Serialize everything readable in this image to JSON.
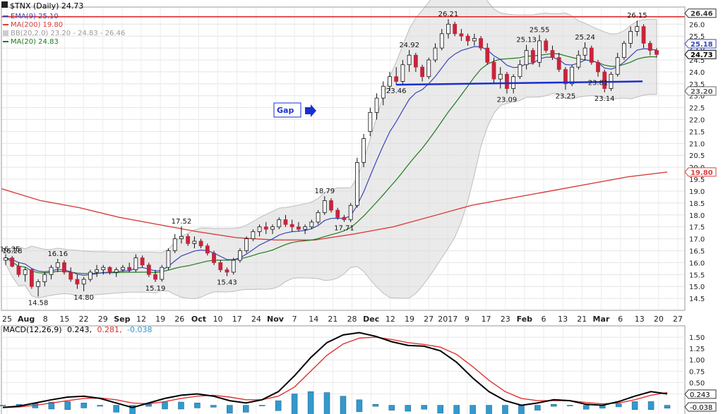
{
  "chart_data": [
    {
      "type": "candlestick",
      "symbol_label": "$TNX (Daily) 24.73",
      "legend": [
        {
          "name": "EMA(9) 25.10",
          "color": "#3a46b8"
        },
        {
          "name": "MA(200) 19.80",
          "color": "#d84040"
        },
        {
          "name": "BB(20,2.0) 23.20 - 24.83 - 26.46",
          "color": "#9a9a9a"
        },
        {
          "name": "MA(20) 24.83",
          "color": "#1e7a1e"
        }
      ],
      "ylim": [
        14.0,
        26.6
      ],
      "y_ticks": [
        "14.5",
        "15.0",
        "15.5",
        "16.0",
        "16.5",
        "17.0",
        "17.5",
        "18.0",
        "18.5",
        "19.0",
        "19.5",
        "20.0",
        "20.5",
        "21.0",
        "21.5",
        "22.0",
        "22.5",
        "23.0",
        "23.5",
        "24.0",
        "24.5",
        "25.0",
        "25.5",
        "26.0"
      ],
      "x_labels": [
        "25",
        "Aug",
        "8",
        "15",
        "22",
        "29",
        "Sep",
        "12",
        "19",
        "26",
        "Oct",
        "10",
        "17",
        "24",
        "Nov",
        "7",
        "14",
        "21",
        "28",
        "Dec",
        "12",
        "19",
        "27",
        "2017",
        "9",
        "17",
        "23",
        "Feb",
        "6",
        "13",
        "21",
        "Mar",
        "6",
        "13",
        "20",
        "27"
      ],
      "price_tags": [
        {
          "text": "26.46",
          "value": 26.46,
          "color": "#333333"
        },
        {
          "text": "25.18",
          "value": 25.18,
          "color": "#3a46b8"
        },
        {
          "text": "24.73",
          "value": 24.73,
          "color": "#000000"
        },
        {
          "text": "23.20",
          "value": 23.2,
          "color": "#666666"
        },
        {
          "text": "19.80",
          "value": 19.8,
          "color": "#d84040"
        }
      ],
      "annotations": [
        {
          "text": "16.28",
          "value": 16.28
        },
        {
          "text": "16.16",
          "value": 16.16
        },
        {
          "text": "14.58",
          "value": 14.58
        },
        {
          "text": "14.80",
          "value": 14.8
        },
        {
          "text": "16.35",
          "value": 16.35
        },
        {
          "text": "15.19",
          "value": 15.19
        },
        {
          "text": "17.52",
          "value": 17.52
        },
        {
          "text": "15.43",
          "value": 15.43
        },
        {
          "text": "18.79",
          "value": 18.79
        },
        {
          "text": "17.71",
          "value": 17.71
        },
        {
          "text": "24.92",
          "value": 24.92
        },
        {
          "text": "23.46",
          "value": 23.46
        },
        {
          "text": "26.21",
          "value": 26.21
        },
        {
          "text": "25.13",
          "value": 25.13
        },
        {
          "text": "25.55",
          "value": 25.55
        },
        {
          "text": "23.09",
          "value": 23.09
        },
        {
          "text": "23.81",
          "value": 23.81
        },
        {
          "text": "25.24",
          "value": 25.24
        },
        {
          "text": "23.25",
          "value": 23.25
        },
        {
          "text": "26.15",
          "value": 26.15
        },
        {
          "text": "23.14",
          "value": 23.14
        }
      ],
      "resistance_level": 26.46,
      "support_line": {
        "from": "Nov 28",
        "to": "Mar 20",
        "start_value": 23.46,
        "end_value": 23.6
      },
      "callout": {
        "text": "Gap",
        "color": "#1a2fd0"
      },
      "ma200": [
        19.1,
        18.6,
        18.3,
        17.9,
        17.6,
        17.3,
        17.05,
        16.95,
        16.95,
        17.2,
        17.5,
        17.95,
        18.4,
        18.7,
        19.0,
        19.3,
        19.6,
        19.8
      ],
      "candles": [
        [
          16.1,
          16.35,
          15.9,
          16.2
        ],
        [
          16.2,
          16.28,
          15.8,
          15.85
        ],
        [
          15.85,
          16.0,
          15.4,
          15.5
        ],
        [
          15.5,
          15.8,
          15.2,
          15.7
        ],
        [
          15.7,
          15.75,
          14.9,
          15.0
        ],
        [
          15.0,
          15.3,
          14.58,
          15.2
        ],
        [
          15.2,
          15.6,
          15.0,
          15.5
        ],
        [
          15.5,
          15.9,
          15.3,
          15.8
        ],
        [
          15.8,
          16.16,
          15.6,
          16.0
        ],
        [
          16.0,
          16.1,
          15.5,
          15.6
        ],
        [
          15.6,
          15.8,
          15.2,
          15.3
        ],
        [
          15.3,
          15.5,
          14.9,
          15.1
        ],
        [
          15.1,
          15.4,
          14.8,
          15.3
        ],
        [
          15.3,
          15.7,
          15.2,
          15.6
        ],
        [
          15.6,
          15.9,
          15.4,
          15.7
        ],
        [
          15.7,
          15.9,
          15.5,
          15.8
        ],
        [
          15.8,
          15.85,
          15.5,
          15.6
        ],
        [
          15.6,
          15.8,
          15.4,
          15.7
        ],
        [
          15.7,
          15.9,
          15.6,
          15.8
        ],
        [
          15.8,
          16.0,
          15.6,
          15.7
        ],
        [
          15.7,
          16.35,
          15.6,
          16.2
        ],
        [
          16.2,
          16.3,
          15.8,
          15.9
        ],
        [
          15.9,
          16.0,
          15.4,
          15.5
        ],
        [
          15.5,
          15.7,
          15.19,
          15.3
        ],
        [
          15.3,
          15.9,
          15.2,
          15.8
        ],
        [
          15.8,
          16.6,
          15.7,
          16.5
        ],
        [
          16.5,
          17.2,
          16.4,
          17.0
        ],
        [
          17.0,
          17.52,
          16.8,
          17.1
        ],
        [
          17.1,
          17.2,
          16.7,
          16.8
        ],
        [
          16.8,
          17.1,
          16.6,
          16.9
        ],
        [
          16.9,
          17.0,
          16.6,
          16.7
        ],
        [
          16.7,
          16.8,
          16.3,
          16.4
        ],
        [
          16.4,
          16.5,
          15.9,
          16.0
        ],
        [
          16.0,
          16.1,
          15.6,
          15.7
        ],
        [
          15.7,
          15.8,
          15.43,
          15.6
        ],
        [
          15.6,
          16.2,
          15.5,
          16.1
        ],
        [
          16.1,
          16.6,
          16.0,
          16.5
        ],
        [
          16.5,
          17.1,
          16.4,
          17.0
        ],
        [
          17.0,
          17.4,
          16.9,
          17.3
        ],
        [
          17.3,
          17.6,
          17.1,
          17.5
        ],
        [
          17.5,
          17.7,
          17.2,
          17.4
        ],
        [
          17.4,
          17.6,
          17.2,
          17.5
        ],
        [
          17.5,
          17.9,
          17.4,
          17.8
        ],
        [
          17.8,
          18.0,
          17.5,
          17.6
        ],
        [
          17.6,
          17.8,
          17.3,
          17.5
        ],
        [
          17.5,
          17.7,
          17.3,
          17.4
        ],
        [
          17.4,
          17.6,
          17.2,
          17.5
        ],
        [
          17.5,
          17.8,
          17.4,
          17.7
        ],
        [
          17.7,
          18.2,
          17.6,
          18.1
        ],
        [
          18.1,
          18.79,
          18.0,
          18.6
        ],
        [
          18.6,
          18.7,
          18.1,
          18.2
        ],
        [
          18.2,
          18.3,
          17.8,
          17.9
        ],
        [
          17.9,
          18.0,
          17.71,
          17.8
        ],
        [
          17.8,
          18.5,
          17.7,
          18.4
        ],
        [
          18.4,
          20.4,
          18.3,
          20.2
        ],
        [
          20.2,
          21.4,
          20.0,
          21.2
        ],
        [
          21.5,
          22.5,
          21.3,
          22.3
        ],
        [
          22.3,
          23.1,
          22.0,
          22.9
        ],
        [
          22.9,
          23.6,
          22.6,
          23.4
        ],
        [
          23.4,
          24.0,
          23.2,
          23.8
        ],
        [
          23.8,
          24.2,
          23.46,
          23.6
        ],
        [
          23.6,
          24.5,
          23.5,
          24.3
        ],
        [
          24.3,
          24.92,
          24.0,
          24.7
        ],
        [
          24.7,
          24.8,
          24.0,
          24.2
        ],
        [
          24.2,
          24.3,
          23.6,
          23.8
        ],
        [
          23.8,
          24.6,
          23.7,
          24.5
        ],
        [
          24.5,
          25.2,
          24.4,
          25.0
        ],
        [
          25.0,
          25.8,
          24.9,
          25.6
        ],
        [
          25.6,
          26.21,
          25.4,
          26.0
        ],
        [
          26.0,
          26.1,
          25.5,
          25.6
        ],
        [
          25.6,
          25.8,
          25.3,
          25.5
        ],
        [
          25.5,
          25.6,
          25.1,
          25.3
        ],
        [
          25.3,
          25.6,
          25.1,
          25.4
        ],
        [
          25.4,
          25.5,
          24.9,
          25.0
        ],
        [
          25.0,
          25.2,
          24.3,
          24.4
        ],
        [
          24.4,
          24.6,
          23.5,
          23.7
        ],
        [
          23.7,
          24.2,
          23.3,
          23.9
        ],
        [
          23.9,
          24.0,
          23.09,
          23.3
        ],
        [
          23.3,
          23.9,
          23.1,
          23.8
        ],
        [
          23.8,
          24.5,
          23.7,
          24.3
        ],
        [
          24.3,
          25.13,
          24.1,
          24.9
        ],
        [
          24.9,
          25.0,
          24.3,
          24.4
        ],
        [
          24.4,
          25.55,
          24.2,
          25.3
        ],
        [
          25.3,
          25.4,
          24.8,
          24.9
        ],
        [
          24.9,
          25.1,
          24.5,
          24.6
        ],
        [
          24.6,
          24.8,
          24.0,
          24.1
        ],
        [
          24.1,
          24.2,
          23.25,
          23.5
        ],
        [
          23.5,
          24.3,
          23.4,
          24.2
        ],
        [
          24.2,
          24.9,
          24.1,
          24.7
        ],
        [
          24.7,
          25.24,
          24.5,
          25.0
        ],
        [
          25.0,
          25.1,
          24.3,
          24.4
        ],
        [
          24.4,
          24.5,
          23.8,
          24.0
        ],
        [
          24.0,
          24.1,
          23.14,
          23.3
        ],
        [
          23.3,
          24.0,
          23.2,
          23.9
        ],
        [
          23.9,
          24.8,
          23.8,
          24.6
        ],
        [
          24.6,
          25.3,
          24.5,
          25.2
        ],
        [
          25.2,
          25.9,
          25.0,
          25.7
        ],
        [
          25.7,
          26.15,
          25.5,
          25.9
        ],
        [
          25.9,
          26.0,
          25.0,
          25.2
        ],
        [
          25.2,
          25.3,
          24.7,
          24.9
        ],
        [
          24.9,
          25.0,
          24.6,
          24.73
        ]
      ]
    },
    {
      "type": "line",
      "label": "MACD(12,26,9)",
      "values_text": {
        "macd": "0.243,",
        "signal": "0.281,",
        "hist": "-0.038"
      },
      "colors": {
        "macd": "#000000",
        "signal": "#e03030",
        "hist": "#3399cc"
      },
      "ylim": [
        -0.1,
        1.75
      ],
      "y_ticks": [
        "1.50",
        "1.25",
        "1.00",
        "0.75",
        "0.50",
        "0.25"
      ],
      "price_tags": [
        {
          "text": "0.243",
          "value": 0.243
        },
        {
          "text": "-0.038",
          "value": -0.038
        }
      ],
      "macd": [
        -0.05,
        -0.02,
        0.05,
        0.12,
        0.18,
        0.2,
        0.15,
        0.05,
        -0.05,
        0.05,
        0.15,
        0.22,
        0.25,
        0.2,
        0.1,
        0.05,
        0.12,
        0.3,
        0.65,
        1.05,
        1.38,
        1.55,
        1.6,
        1.52,
        1.4,
        1.32,
        1.3,
        1.2,
        0.95,
        0.6,
        0.3,
        0.1,
        0.0,
        0.05,
        0.12,
        0.1,
        0.02,
        0.0,
        0.08,
        0.2,
        0.3,
        0.25
      ],
      "signal": [
        -0.05,
        -0.04,
        0.0,
        0.05,
        0.1,
        0.15,
        0.16,
        0.12,
        0.05,
        0.03,
        0.08,
        0.15,
        0.2,
        0.22,
        0.18,
        0.12,
        0.12,
        0.2,
        0.4,
        0.75,
        1.1,
        1.35,
        1.48,
        1.5,
        1.45,
        1.38,
        1.34,
        1.28,
        1.12,
        0.85,
        0.55,
        0.3,
        0.15,
        0.1,
        0.1,
        0.1,
        0.06,
        0.03,
        0.05,
        0.12,
        0.22,
        0.28
      ]
    }
  ]
}
